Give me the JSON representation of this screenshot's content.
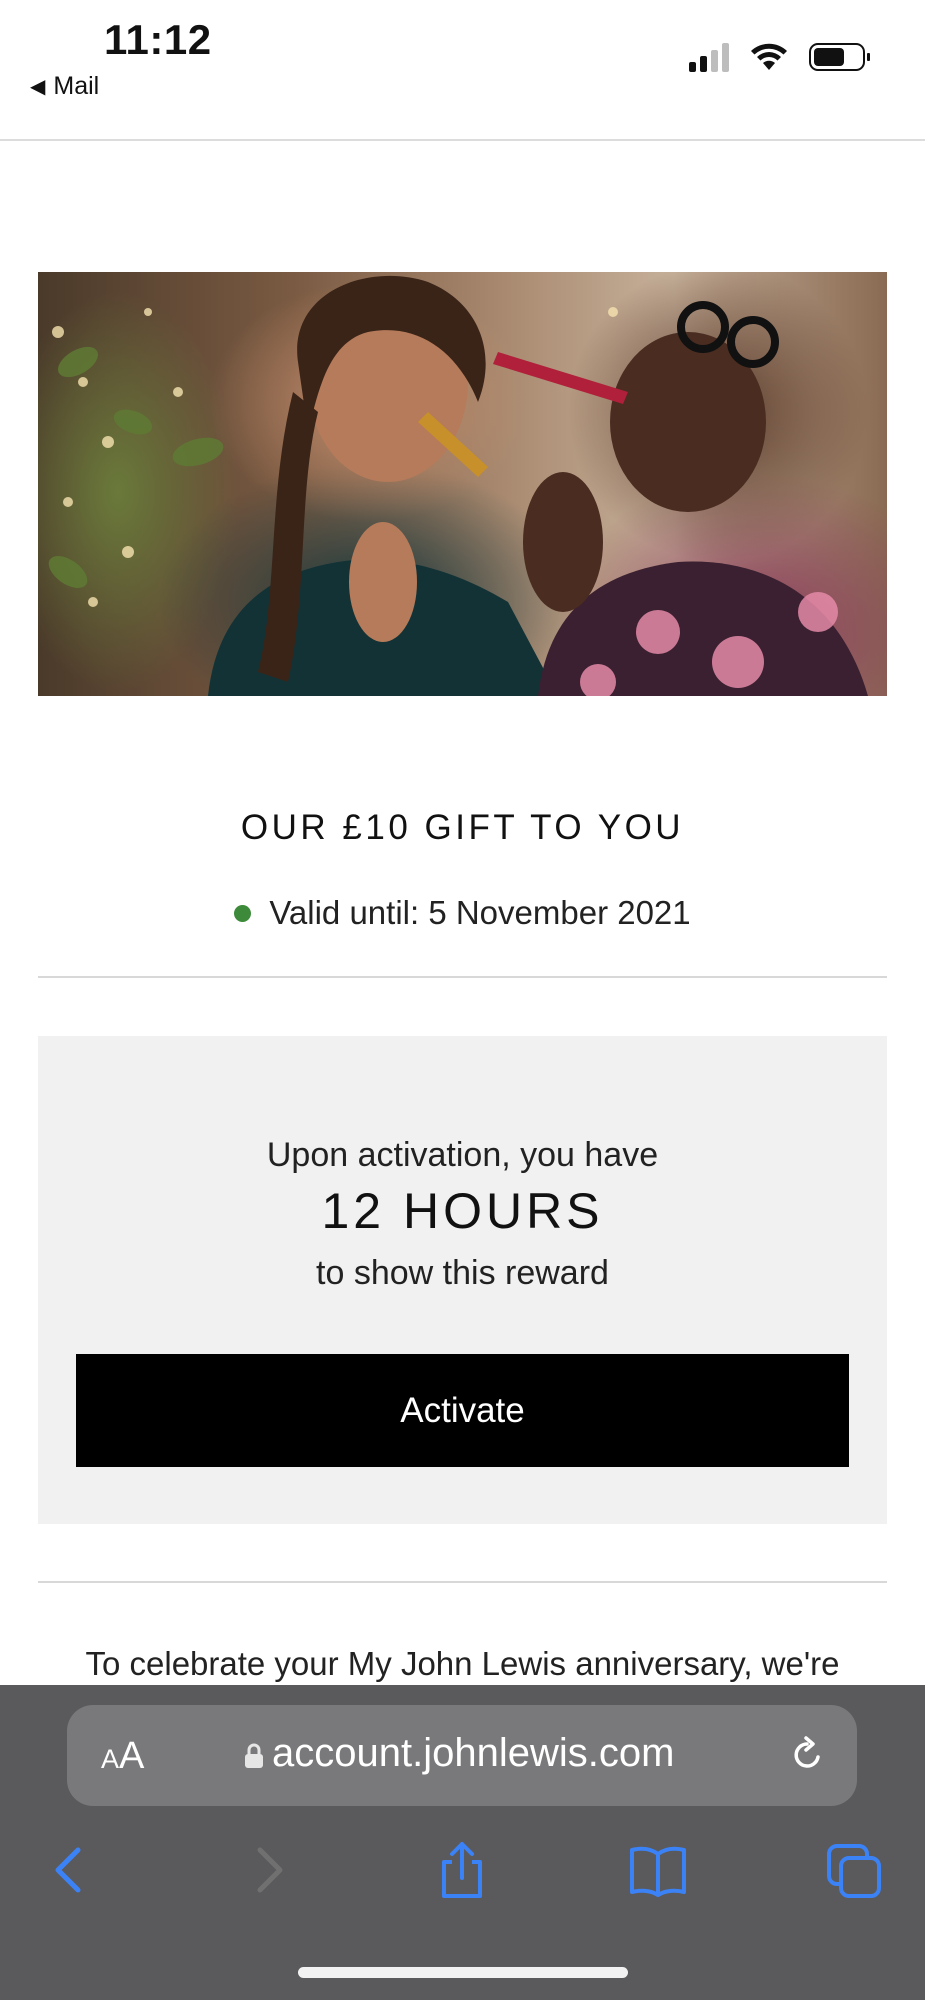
{
  "status_bar": {
    "time": "11:12",
    "back_label": "Mail"
  },
  "hero_image": {
    "description_icon": "photo-two-women-party-blowers"
  },
  "offer": {
    "title": "OUR £10 GIFT TO YOU",
    "valid_until": "Valid until: 5 November 2021",
    "status_color": "#3d8a3a"
  },
  "reward": {
    "activation_line": "Upon activation, you have",
    "hours": "12 HOURS",
    "show_line": "to show this reward",
    "activate_label": "Activate"
  },
  "body": {
    "intro_text": "To celebrate your My John Lewis anniversary, we're"
  },
  "safari": {
    "text_size_label_big": "A",
    "text_size_label_small": "A",
    "url": "account.johnlewis.com",
    "accent_color": "#3b82f6"
  }
}
